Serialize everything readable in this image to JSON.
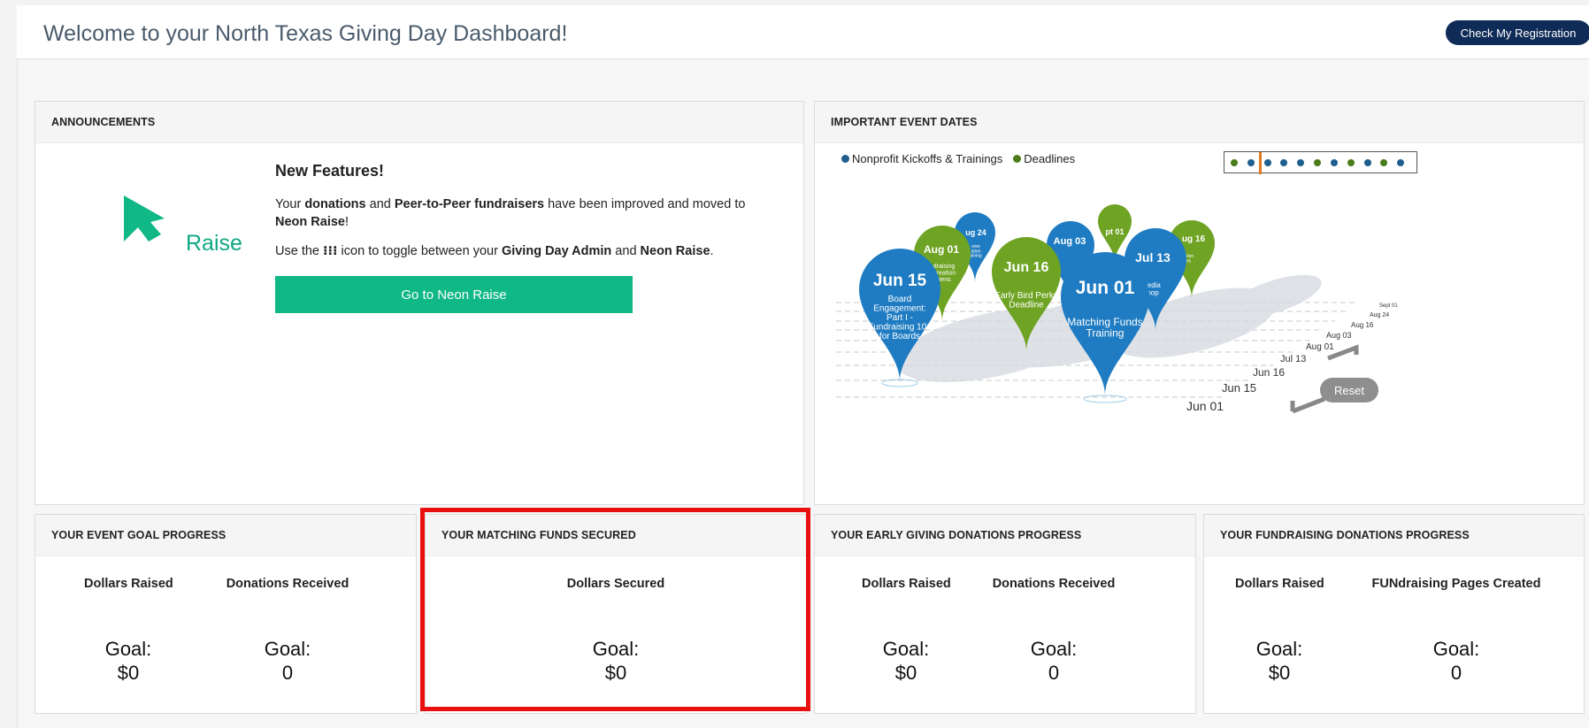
{
  "header": {
    "title": "Welcome to your North Texas Giving Day Dashboard!",
    "registration_button": "Check My Registration"
  },
  "announcements": {
    "heading": "ANNOUNCEMENTS",
    "logo_text": "Raise",
    "title": "New Features!",
    "paragraph1": {
      "t1": "Your ",
      "b1": "donations",
      "t2": " and ",
      "b2": "Peer-to-Peer fundraisers",
      "t3": " have been improved and moved to ",
      "b3": "Neon Raise",
      "t4": "!"
    },
    "paragraph2": {
      "t1": "Use the ",
      "icon": "⁝⁝⁝",
      "t2": " icon to toggle between your ",
      "b1": "Giving Day Admin",
      "t3": " and ",
      "b2": "Neon Raise",
      "t4": "."
    },
    "button": "Go to Neon Raise"
  },
  "event_dates": {
    "heading": "IMPORTANT EVENT DATES",
    "legend": [
      {
        "label": "Nonprofit Kickoffs & Trainings",
        "color": "#1f5f8f"
      },
      {
        "label": "Deadlines",
        "color": "#4a7d1a"
      }
    ],
    "pins": {
      "sep01": {
        "date": "pt 01"
      },
      "aug24": {
        "date": "ug 24",
        "label": "onor\nation\naining"
      },
      "aug01": {
        "date": "Aug 01",
        "label": "draising\nCreation\npens"
      },
      "aug16": {
        "date": "ug 16",
        "label": "stration\noses"
      },
      "aug03": {
        "date": "Aug 03"
      },
      "jul13": {
        "date": "Jul 13",
        "label": "l Media\nkshop"
      },
      "jun16": {
        "date": "Jun 16",
        "label": "Early Bird Perks\nDeadline"
      },
      "jun15": {
        "date": "Jun 15",
        "label": "Board\nEngagement:\nPart I -\nFundraising 101\nfor Boards"
      },
      "jun01": {
        "date": "Jun 01",
        "label": "Matching Funds\nTraining"
      }
    },
    "axis_labels": [
      "Sept 01",
      "Aug 24",
      "Aug 16",
      "Aug 03",
      "Aug 01",
      "Jul 13",
      "Jun 16",
      "Jun 15",
      "Jun 01"
    ],
    "reset_button": "Reset"
  },
  "stats": {
    "event_goal": {
      "heading": "YOUR EVENT GOAL PROGRESS",
      "columns": [
        {
          "label": "Dollars Raised",
          "goal_label": "Goal:",
          "goal": "$0"
        },
        {
          "label": "Donations Received",
          "goal_label": "Goal:",
          "goal": "0"
        }
      ]
    },
    "matching": {
      "heading": "YOUR MATCHING FUNDS SECURED",
      "columns": [
        {
          "label": "Dollars Secured",
          "goal_label": "Goal:",
          "goal": "$0"
        }
      ]
    },
    "early_giving": {
      "heading": "YOUR EARLY GIVING DONATIONS PROGRESS",
      "columns": [
        {
          "label": "Dollars Raised",
          "goal_label": "Goal:",
          "goal": "$0"
        },
        {
          "label": "Donations Received",
          "goal_label": "Goal:",
          "goal": "0"
        }
      ]
    },
    "fundraising": {
      "heading": "YOUR FUNDRAISING DONATIONS PROGRESS",
      "columns": [
        {
          "label": "Dollars Raised",
          "goal_label": "Goal:",
          "goal": "$0"
        },
        {
          "label": "FUNdraising Pages Created",
          "goal_label": "Goal:",
          "goal": "0"
        }
      ]
    }
  },
  "colors": {
    "header_button": "#0f2b57",
    "raise_green": "#10b886",
    "highlight": "#e8100f",
    "pin_blue": "#1f7cc2",
    "pin_green": "#6fa323"
  }
}
